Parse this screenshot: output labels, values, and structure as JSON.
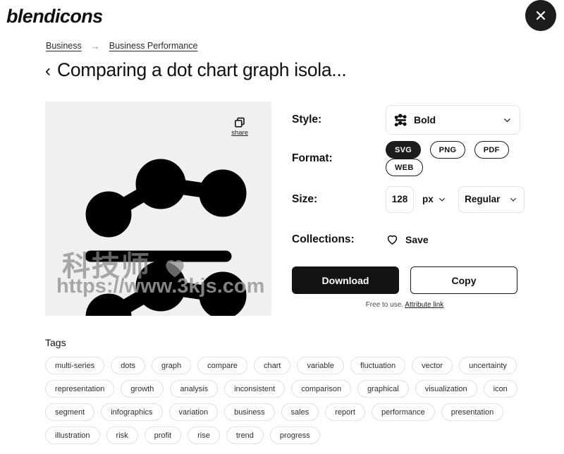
{
  "brand": {
    "logo_text": "blendicons"
  },
  "window": {
    "close_label": "✕"
  },
  "breadcrumb": {
    "items": [
      {
        "label": "Business"
      },
      {
        "label": "Business Performance"
      }
    ],
    "separator": "→"
  },
  "header": {
    "back_chevron": "‹",
    "title": "Comparing a dot chart graph isola..."
  },
  "preview": {
    "share_label": "share",
    "watermark_cn": "科技师",
    "watermark_url": "https://www.3kjs.com",
    "background": "#f0f0f0",
    "icon_color": "#000000"
  },
  "controls": {
    "style": {
      "label": "Style:",
      "value": "Bold",
      "chevron": "⌄"
    },
    "format": {
      "label": "Format:",
      "options": [
        {
          "label": "SVG",
          "selected": true
        },
        {
          "label": "PNG",
          "selected": false
        },
        {
          "label": "PDF",
          "selected": false
        },
        {
          "label": "WEB",
          "selected": false
        }
      ]
    },
    "size": {
      "label": "Size:",
      "value": "128",
      "unit": "px",
      "weight": "Regular",
      "chevron": "⌄"
    },
    "collections": {
      "label": "Collections:",
      "save_label": "Save"
    },
    "actions": {
      "download_label": "Download",
      "copy_label": "Copy"
    },
    "license": {
      "text": "Free to use.",
      "link_label": "Attribute link"
    }
  },
  "tags": {
    "heading": "Tags",
    "items": [
      "multi-series",
      "dots",
      "graph",
      "compare",
      "chart",
      "variable",
      "fluctuation",
      "vector",
      "uncertainty",
      "representation",
      "growth",
      "analysis",
      "inconsistent",
      "comparison",
      "graphical",
      "visualization",
      "icon",
      "segment",
      "infographics",
      "variation",
      "business",
      "sales",
      "report",
      "performance",
      "presentation",
      "illustration",
      "risk",
      "profit",
      "rise",
      "trend",
      "progress"
    ]
  }
}
